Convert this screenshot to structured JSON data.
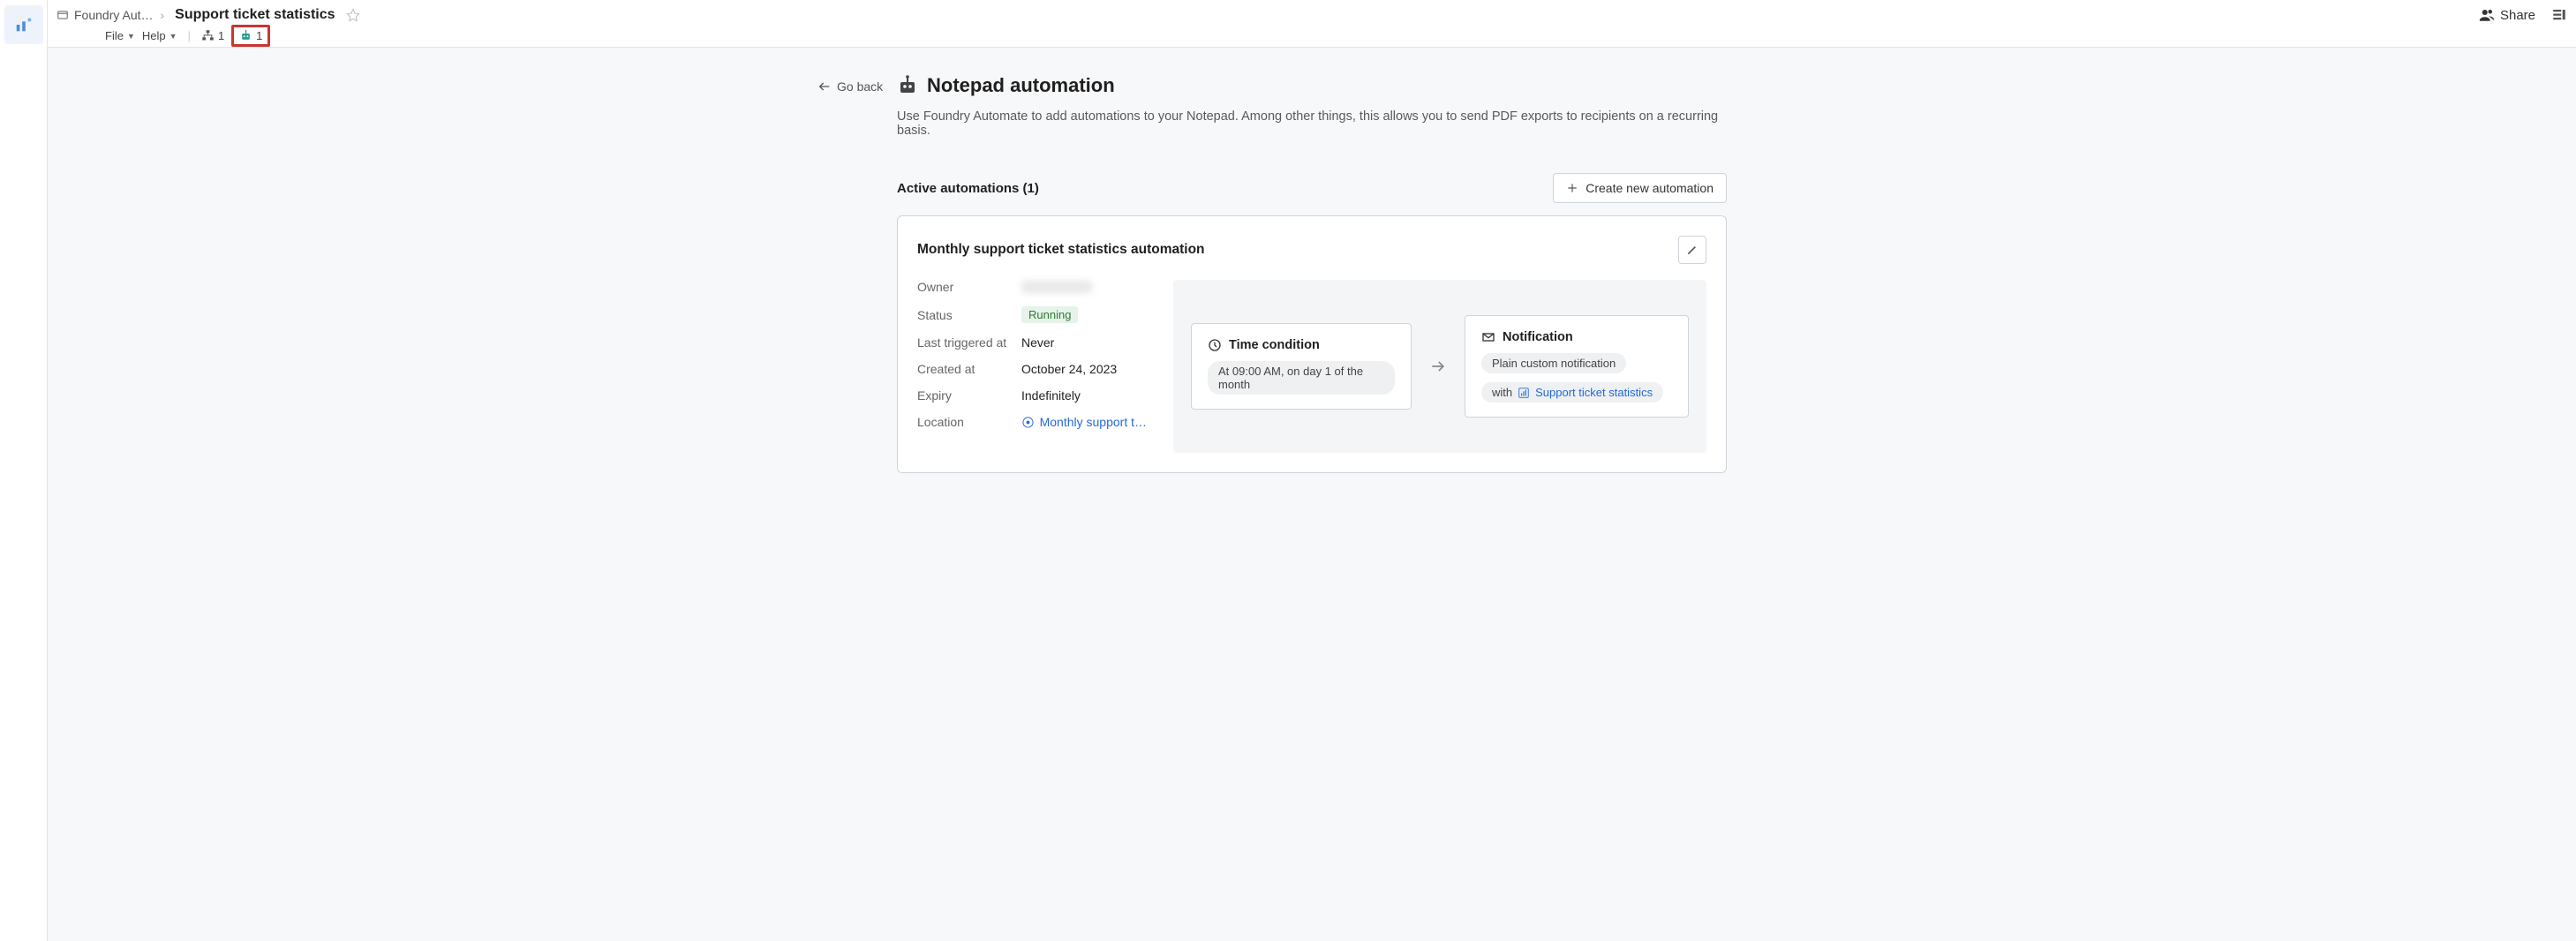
{
  "header": {
    "breadcrumb_folder": "Foundry Aut…",
    "page_title": "Support ticket statistics",
    "file_menu": "File",
    "help_menu": "Help",
    "org_count": "1",
    "robot_count": "1",
    "share_label": "Share"
  },
  "goback_label": "Go back",
  "page": {
    "title": "Notepad automation",
    "subtitle": "Use Foundry Automate to add automations to your Notepad. Among other things, this allows you to send PDF exports to recipients on a recurring basis."
  },
  "section": {
    "title": "Active automations (1)",
    "create_label": "Create new automation"
  },
  "automation": {
    "title": "Monthly support ticket statistics automation",
    "labels": {
      "owner": "Owner",
      "status": "Status",
      "last_triggered": "Last triggered at",
      "created_at": "Created at",
      "expiry": "Expiry",
      "location": "Location"
    },
    "values": {
      "status": "Running",
      "last_triggered": "Never",
      "created_at": "October 24, 2023",
      "expiry": "Indefinitely",
      "location": "Monthly support t…"
    },
    "flow": {
      "condition_title": "Time condition",
      "condition_value": "At 09:00 AM, on day 1 of the month",
      "notification_title": "Notification",
      "notification_chip": "Plain custom notification",
      "with_label": "with",
      "with_link": "Support ticket statistics"
    }
  }
}
